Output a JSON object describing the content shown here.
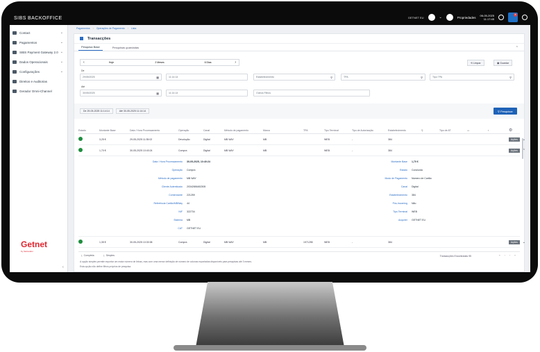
{
  "app": {
    "logo": "SIBS",
    "logo_sub": "BACKOFFICE",
    "merchant": "GETNET EU",
    "user": "Propriedades",
    "date": "06-05-2025",
    "time": "11:17:45",
    "notif_count": "8"
  },
  "sidebar": {
    "items": [
      {
        "label": "Contact",
        "chev": true
      },
      {
        "label": "Pagamentos",
        "chev": true
      },
      {
        "label": "SIBS Payment Gateway 2.0",
        "chev": true
      },
      {
        "label": "Dados Operacionais",
        "chev": true
      },
      {
        "label": "Configurações",
        "chev": true
      },
      {
        "label": "Direitos e Auditorias",
        "chev": false
      },
      {
        "label": "Gerador Omni-Channel",
        "chev": false
      }
    ],
    "brand": "Getnet",
    "brand_sub": "by Santander"
  },
  "breadcrumb": [
    "Pagamentos",
    "Operações de Pagamento",
    "Lista"
  ],
  "page": {
    "title": "Transacções",
    "tabs": [
      "Pesquisa Base",
      "Pesquisas guardadas"
    ]
  },
  "filters": {
    "periods": [
      "Hoje",
      "2 Meses",
      "6 Dias"
    ],
    "from_label": "De",
    "from_date": "29/05/2025",
    "from_time": "11:14:14",
    "to_label": "Até",
    "to_date": "30/05/2025",
    "to_time": "11:14:14",
    "establishment_placeholder": "Estabelecimento",
    "tpa_placeholder": "TPA",
    "tpa_type_placeholder": "Tipo TPA",
    "other_filters_placeholder": "Outros Filtros",
    "clear_label": "Limpar",
    "save_label": "Guardar",
    "search_label": "Pesquisar",
    "chip_from": "De 29-05-2025 11:14:14",
    "chip_to": "Até 30-05-2025 11:14:14"
  },
  "table": {
    "headers": [
      "Estado",
      "Montante Base",
      "Data / Hora Processamento",
      "Operação",
      "Canal",
      "Método de pagamento",
      "Marca",
      "TPA",
      "Tipo Terminal",
      "Tipo de Autorização",
      "Estabelecimento",
      "",
      "Tipo de AT"
    ],
    "rows": [
      {
        "amount": "3,25 €",
        "date": "29-05-2025 11:35:02",
        "operation": "Devolução",
        "channel": "Digital",
        "method": "MB WAY",
        "brand": "MB",
        "tpa": "",
        "terminal": "WEB",
        "auth": "-",
        "est": "384"
      },
      {
        "amount": "1,70 €",
        "date": "30-05-2025 10:40:24",
        "operation": "Compra",
        "channel": "Digital",
        "method": "MB WAY",
        "brand": "MB",
        "tpa": "",
        "terminal": "WEB",
        "auth": "-",
        "est": "384"
      }
    ],
    "last_row": {
      "amount": "1,35 €",
      "date": "30-05-2025 10:30:38",
      "operation": "Compra",
      "channel": "Digital",
      "method": "MB WAY",
      "brand": "MB",
      "tpa": "1971255",
      "terminal": "WEB",
      "auth": "-",
      "est": "384"
    },
    "actions_label": "Ações"
  },
  "detail": {
    "left": [
      {
        "label": "Data / Hora Processamento",
        "value": "30-05-2025, 10:40:24"
      },
      {
        "label": "Operação",
        "value": "Compra"
      },
      {
        "label": "Método de pagamento",
        "value": "MB WAY"
      },
      {
        "label": "Cliente Autenticado",
        "value": "20342656452305"
      },
      {
        "label": "Comerciante",
        "value": "221259"
      },
      {
        "label": "Referência Cartão/MBWay",
        "value": "44"
      },
      {
        "label": "NIF",
        "value": "322734"
      },
      {
        "label": "Sistema",
        "value": "MB"
      },
      {
        "label": "CAT",
        "value": "GETNET EU"
      }
    ],
    "right": [
      {
        "label": "Montante Base",
        "value": "1,70 €"
      },
      {
        "label": "Estado",
        "value": "Concluída"
      },
      {
        "label": "Modo de Pagamento",
        "value": "Número de Cartão"
      },
      {
        "label": "Canal",
        "value": "Digital"
      },
      {
        "label": "Estabelecimento",
        "value": "384"
      },
      {
        "label": "Pós-Incoming",
        "value": "Não"
      },
      {
        "label": "Tipo Terminal",
        "value": "WEB"
      },
      {
        "label": "Acquirer",
        "value": "GETNET EU"
      }
    ]
  },
  "footer": {
    "download_complete": "Completa",
    "download_simple": "Simples",
    "count_text": "Transacções Encontradas 95",
    "note1": "A opção simples permite exportar um maior número de linhas, mas com uma menor definição de número de colunas exportadas disponíveis para pesquisas até 3 meses.",
    "note2": "Esta opção não define filtros próprios de pesquisa."
  }
}
